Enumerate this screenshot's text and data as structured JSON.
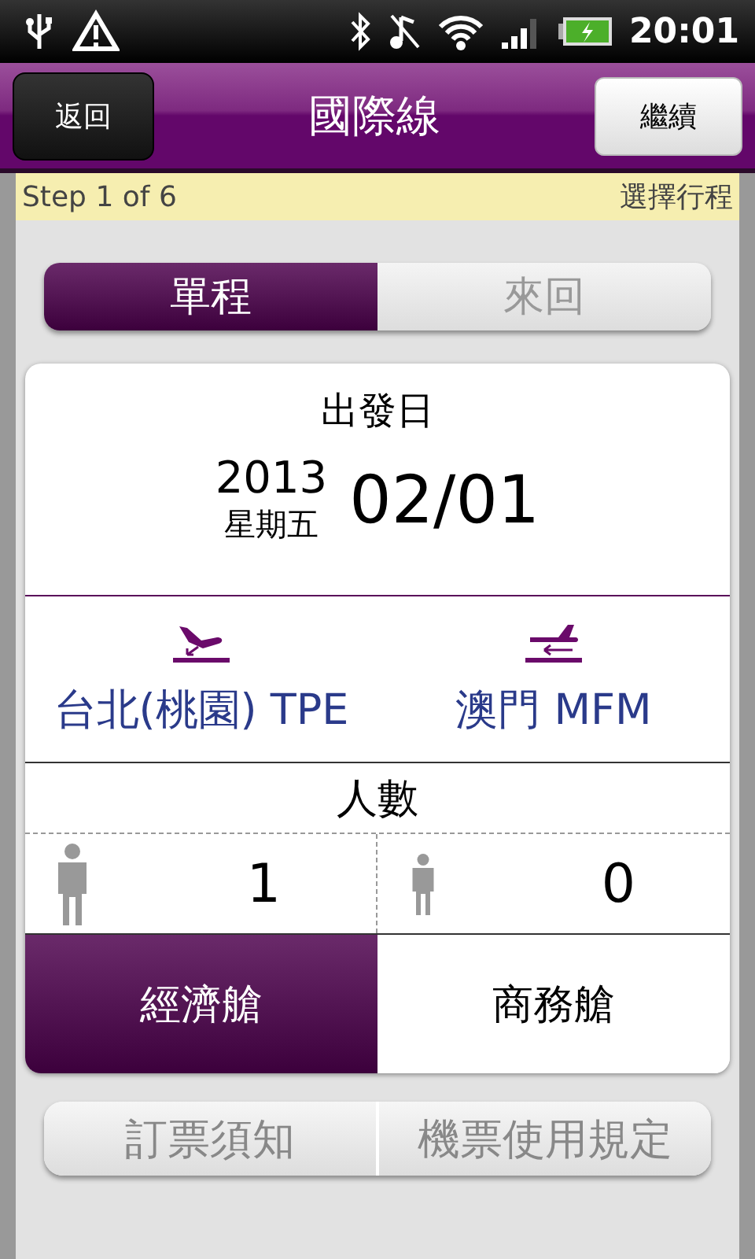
{
  "status_bar": {
    "time": "20:01"
  },
  "header": {
    "back": "返回",
    "title": "國際線",
    "next": "繼續"
  },
  "step": {
    "progress": "Step 1 of 6",
    "name": "選擇行程"
  },
  "trip_type": [
    {
      "label": "單程",
      "selected": true
    },
    {
      "label": "來回",
      "selected": false
    }
  ],
  "date": {
    "label": "出發日",
    "year": "2013",
    "weekday": "星期五",
    "date": "02/01"
  },
  "route": [
    {
      "kind": "departure",
      "city": "台北(桃園) TPE"
    },
    {
      "kind": "arrival",
      "city": "澳門 MFM"
    }
  ],
  "passengers": {
    "label": "人數",
    "groups": [
      {
        "kind": "adult",
        "count": "1"
      },
      {
        "kind": "child",
        "count": "0"
      }
    ]
  },
  "cabin": [
    {
      "label": "經濟艙",
      "selected": true
    },
    {
      "label": "商務艙",
      "selected": false
    }
  ],
  "links": [
    "訂票須知",
    "機票使用規定"
  ]
}
